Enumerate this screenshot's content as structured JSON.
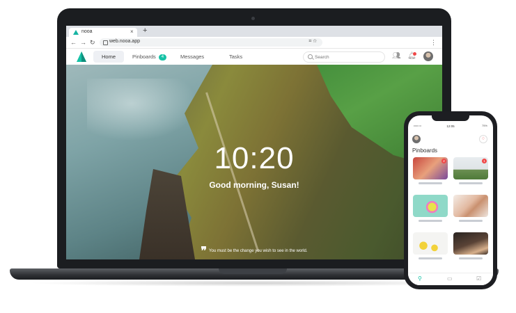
{
  "browser": {
    "tab_title": "nooa",
    "tab_close": "×",
    "new_tab": "+",
    "url": "web.nooa.app",
    "nav": {
      "back": "←",
      "forward": "→",
      "reload": "↻"
    }
  },
  "app": {
    "nav": {
      "home": "Home",
      "pinboards": "Pinboards",
      "pinboards_badge": "4",
      "messages": "Messages",
      "tasks": "Tasks"
    },
    "search": {
      "placeholder": "Search"
    }
  },
  "hero": {
    "time": "10:20",
    "greeting": "Good morning, Susan!",
    "quote": "You must be the change you wish to see in the world."
  },
  "phone": {
    "status_left": "••••• ••",
    "time": "12:05",
    "status_right": "75%",
    "title": "Pinboards",
    "cards": [
      {
        "badge": "2"
      },
      {
        "badge": "1"
      },
      {
        "badge": ""
      },
      {
        "badge": ""
      },
      {
        "badge": ""
      },
      {
        "badge": ""
      }
    ]
  },
  "colors": {
    "brand": "#16c2a6",
    "notification": "#f04848"
  }
}
